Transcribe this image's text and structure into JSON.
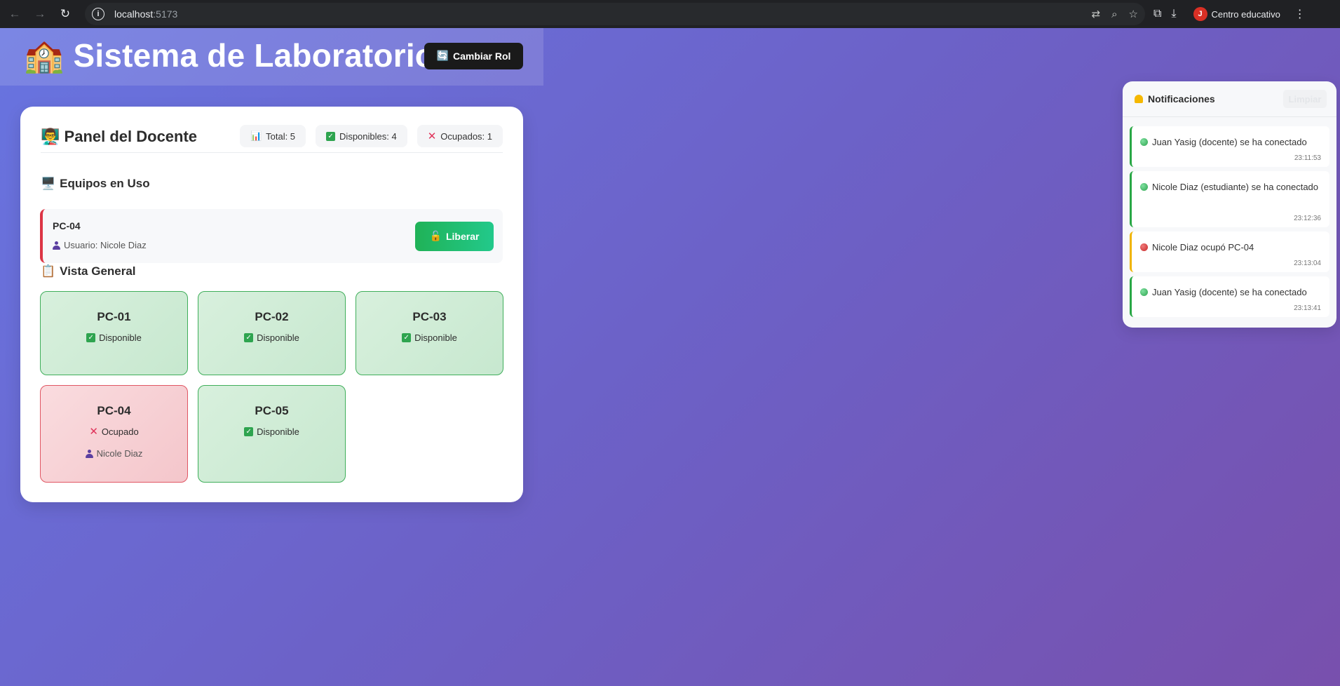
{
  "browser": {
    "url_host": "localhost",
    "url_port": ":5173",
    "profile_initial": "J",
    "profile_name": "Centro educativo"
  },
  "header": {
    "title": "Sistema de Laboratorio",
    "title_icon": "🏫",
    "role_button": "Cambiar Rol",
    "role_icon": "🔄"
  },
  "panel": {
    "title": "Panel del Docente",
    "title_icon": "👨‍🏫",
    "stats": {
      "total": "Total: 5",
      "available": "Disponibles: 4",
      "occupied": "Ocupados: 1"
    },
    "in_use_title": "Equipos en Uso",
    "in_use_icon": "🖥️",
    "in_use": {
      "pc": "PC-04",
      "user": "Usuario: Nicole Diaz",
      "release_button": "Liberar",
      "release_icon": "🔓"
    },
    "overview_title": "Vista General",
    "overview_icon": "📋",
    "computers": [
      {
        "name": "PC-01",
        "status": "Disponible"
      },
      {
        "name": "PC-02",
        "status": "Disponible"
      },
      {
        "name": "PC-03",
        "status": "Disponible"
      },
      {
        "name": "PC-04",
        "status": "Ocupado",
        "user": "Nicole Diaz"
      },
      {
        "name": "PC-05",
        "status": "Disponible"
      }
    ]
  },
  "notifications": {
    "title": "Notificaciones",
    "clear_button": "Limpiar",
    "items": [
      {
        "message": "Juan Yasig (docente) se ha conectado",
        "time": "23:11:53"
      },
      {
        "message": "Nicole Diaz (estudiante) se ha conectado",
        "time": "23:12:36"
      },
      {
        "message": "Nicole Diaz ocupó PC-04",
        "time": "23:13:04"
      },
      {
        "message": "Juan Yasig (docente) se ha conectado",
        "time": "23:13:41"
      }
    ]
  },
  "colors": {
    "accent_green": "#22c98b",
    "busy_red": "#dc3545",
    "warn_yellow": "#f0b400"
  }
}
